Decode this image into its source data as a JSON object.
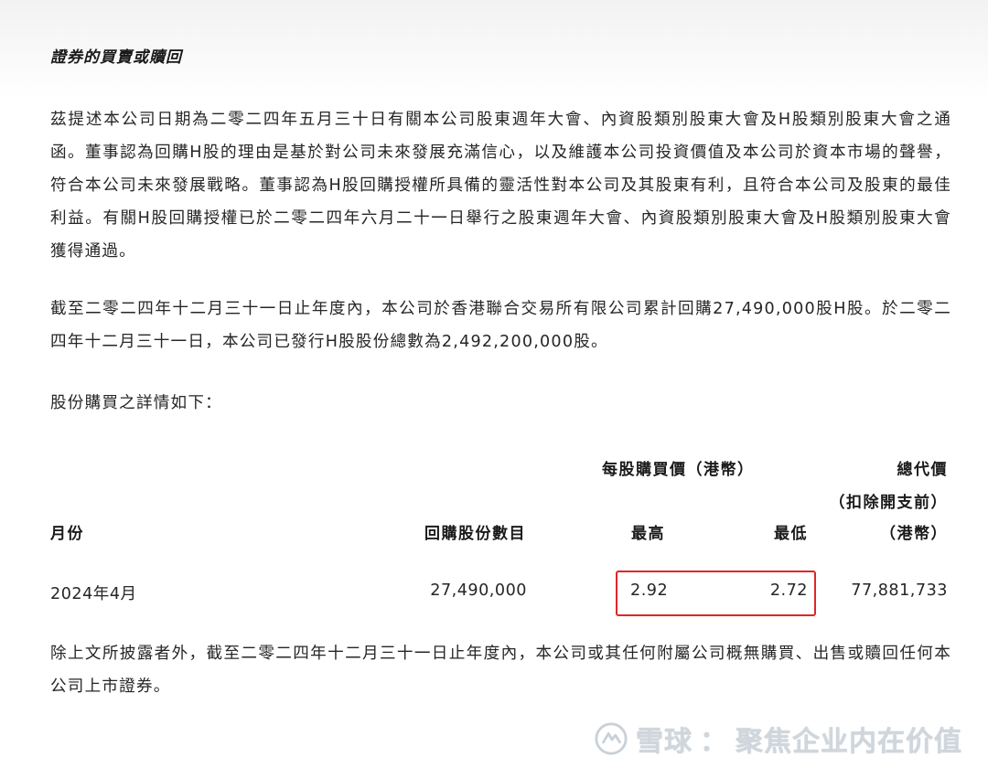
{
  "section_title": "證券的買賣或贖回",
  "paragraphs": {
    "p1": "茲提述本公司日期為二零二四年五月三十日有關本公司股東週年大會、內資股類別股東大會及H股類別股東大會之通函。董事認為回購H股的理由是基於對公司未來發展充滿信心，以及維護本公司投資價值及本公司於資本市場的聲譽，符合本公司未來發展戰略。董事認為H股回購授權所具備的靈活性對本公司及其股東有利，且符合本公司及股東的最佳利益。有關H股回購授權已於二零二四年六月二十一日舉行之股東週年大會、內資股類別股東大會及H股類別股東大會獲得通過。",
    "p2": "截至二零二四年十二月三十一日止年度內，本公司於香港聯合交易所有限公司累計回購27,490,000股H股。於二零二四年十二月三十一日，本公司已發行H股股份總數為2,492,200,000股。",
    "p3": "股份購買之詳情如下：",
    "p4": "除上文所披露者外，截至二零二四年十二月三十一日止年度內，本公司或其任何附屬公司概無購買、出售或贖回任何本公司上市證券。"
  },
  "table": {
    "headers": {
      "price_group": "每股購買價（港幣）",
      "total_line1": "總代價",
      "total_line2": "（扣除開支前）",
      "total_line3": "（港幣）",
      "month": "月份",
      "shares": "回購股份數目",
      "high": "最高",
      "low": "最低"
    },
    "rows": [
      {
        "month": "2024年4月",
        "shares": "27,490,000",
        "high": "2.92",
        "low": "2.72",
        "total": "77,881,733"
      }
    ]
  },
  "watermark": {
    "brand": "雪球",
    "separator": "：",
    "account": "聚焦企业内在价值"
  },
  "colors": {
    "highlight_box": "#e22525",
    "text": "#262626",
    "watermark": "#cfd6dc"
  }
}
